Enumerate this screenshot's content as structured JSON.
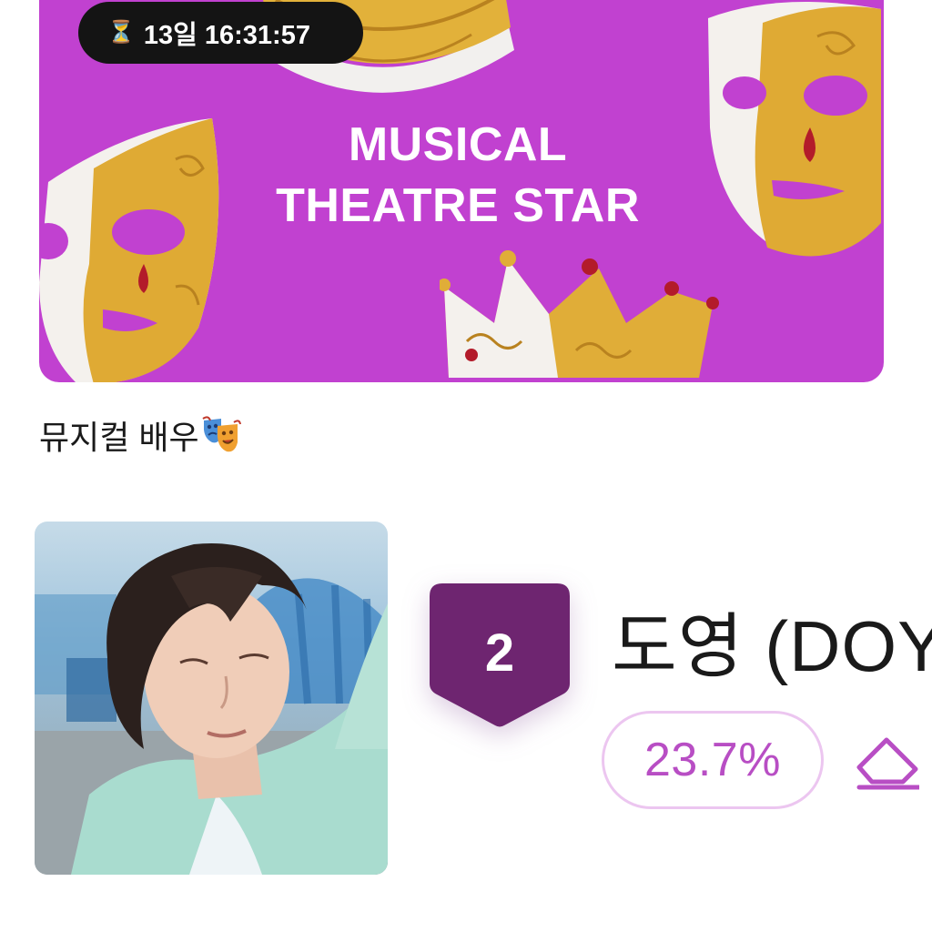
{
  "banner": {
    "title_line1": "MUSICAL",
    "title_line2": "THEATRE STAR",
    "background_color": "#c141d0"
  },
  "timer": {
    "icon": "hourglass-icon",
    "glyph": "⏳",
    "text": "13일 16:31:57"
  },
  "category": {
    "label": "뮤지컬 배우",
    "emoji_icon": "performing-arts-icon"
  },
  "nominee": {
    "rank": "2",
    "name": "도영 (DOY",
    "percent": "23.7%",
    "rank_badge_color": "#6e2570",
    "accent_color": "#b84ec4",
    "action_icon": "eraser-icon"
  }
}
